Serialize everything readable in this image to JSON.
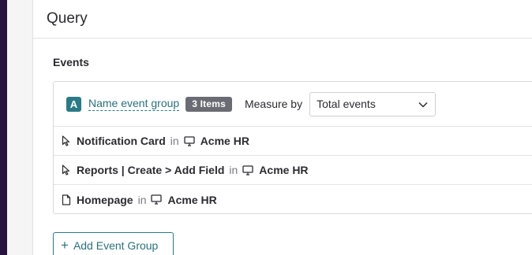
{
  "panel": {
    "title": "Query"
  },
  "events": {
    "section_title": "Events",
    "group": {
      "badge": "A",
      "name": "Name event group",
      "items_count": "3 Items",
      "measure_label": "Measure by",
      "measure_value": "Total events"
    },
    "rows": [
      {
        "icon": "cursor-icon",
        "name": "Notification Card",
        "in": "in",
        "app_icon": "monitor-icon",
        "app": "Acme HR"
      },
      {
        "icon": "cursor-icon",
        "name": "Reports | Create > Add Field",
        "in": "in",
        "app_icon": "monitor-icon",
        "app": "Acme HR"
      },
      {
        "icon": "page-icon",
        "name": "Homepage",
        "in": "in",
        "app_icon": "monitor-icon",
        "app": "Acme HR"
      }
    ]
  },
  "actions": {
    "add_event_group": "Add Event Group"
  },
  "colors": {
    "accent": "#2b7a86",
    "sidebar": "#26143e",
    "pill": "#6b6b73"
  }
}
